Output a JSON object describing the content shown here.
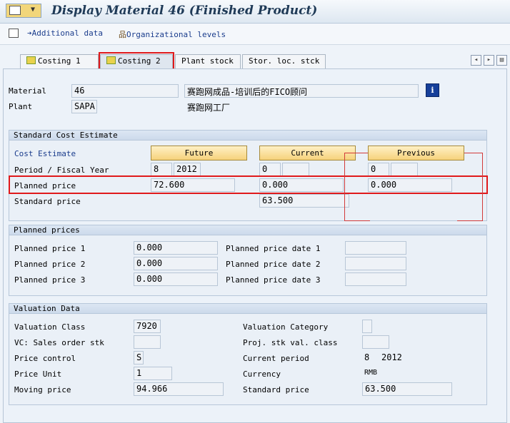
{
  "window": {
    "title": "Display Material 46 (Finished Product)"
  },
  "toolbar": {
    "additional_data": "Additional data",
    "org_levels": "Organizational levels"
  },
  "tabs": [
    {
      "label": "Costing 1"
    },
    {
      "label": "Costing 2"
    },
    {
      "label": "Plant stock"
    },
    {
      "label": "Stor. loc. stck"
    }
  ],
  "header": {
    "material_label": "Material",
    "material": "46",
    "material_desc": "赛跑网成品-培训后的FICO顾问",
    "plant_label": "Plant",
    "plant": "SAPA",
    "plant_desc": "赛跑网工厂"
  },
  "std_cost": {
    "title": "Standard Cost Estimate",
    "cost_estimate_label": "Cost Estimate",
    "future_btn": "Future",
    "current_btn": "Current",
    "previous_btn": "Previous",
    "period_label": "Period / Fiscal Year",
    "future_period": "8",
    "future_year": "2012",
    "current_period": "0",
    "current_year": "",
    "previous_period": "0",
    "previous_year": "",
    "planned_price_label": "Planned price",
    "planned_future": "72.600",
    "planned_current": "0.000",
    "planned_previous": "0.000",
    "standard_price_label": "Standard price",
    "standard_price": "63.500"
  },
  "planned_prices": {
    "title": "Planned prices",
    "pp1_label": "Planned price 1",
    "pp1": "0.000",
    "pp2_label": "Planned price 2",
    "pp2": "0.000",
    "pp3_label": "Planned price 3",
    "pp3": "0.000",
    "pd1_label": "Planned price date 1",
    "pd1": "",
    "pd2_label": "Planned price date 2",
    "pd2": "",
    "pd3_label": "Planned price date 3",
    "pd3": ""
  },
  "valuation": {
    "title": "Valuation Data",
    "val_class_label": "Valuation Class",
    "val_class": "7920",
    "vc_label": "VC: Sales order stk",
    "vc": "",
    "price_control_label": "Price control",
    "price_control": "S",
    "price_unit_label": "Price Unit",
    "price_unit": "1",
    "moving_price_label": "Moving price",
    "moving_price": "94.966",
    "val_category_label": "Valuation Category",
    "val_category": "",
    "proj_label": "Proj. stk val. class",
    "proj": "",
    "current_period_label": "Current period",
    "current_period": "8",
    "current_year": "2012",
    "currency_label": "Currency",
    "currency": "RMB",
    "std_price_label": "Standard price",
    "std_price": "63.500"
  },
  "colors": {
    "highlight": "#e0191b",
    "button_yellow": "#f6d27b",
    "link_blue": "#1a3c8c"
  }
}
